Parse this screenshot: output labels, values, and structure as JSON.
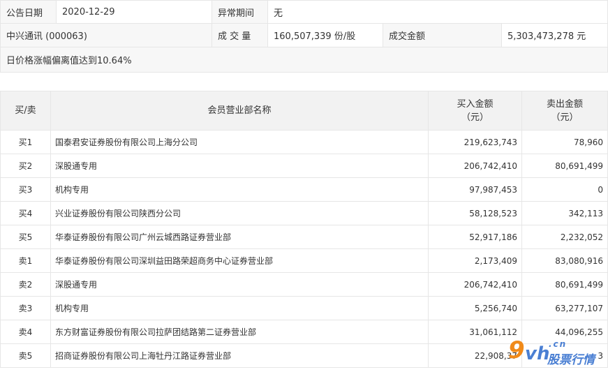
{
  "header": {
    "announce_date_label": "公告日期",
    "announce_date": "2020-12-29",
    "abnormal_period_label": "异常期间",
    "abnormal_period": "无",
    "stock": "中兴通讯 (000063)",
    "volume_label": "成 交 量",
    "volume": "160,507,339 份/股",
    "turnover_label": "成交金额",
    "turnover": "5,303,473,278 元",
    "reason": "日价格涨幅偏离值达到10.64%"
  },
  "table": {
    "col_side": "买/卖",
    "col_name": "会员营业部名称",
    "col_buy_l1": "买入金额",
    "col_buy_l2": "（元）",
    "col_sell_l1": "卖出金额",
    "col_sell_l2": "（元）",
    "rows": [
      {
        "side": "买1",
        "name": "国泰君安证券股份有限公司上海分公司",
        "buy": "219,623,743",
        "sell": "78,960"
      },
      {
        "side": "买2",
        "name": "深股通专用",
        "buy": "206,742,410",
        "sell": "80,691,499"
      },
      {
        "side": "买3",
        "name": "机构专用",
        "buy": "97,987,453",
        "sell": "0"
      },
      {
        "side": "买4",
        "name": "兴业证券股份有限公司陕西分公司",
        "buy": "58,128,523",
        "sell": "342,113"
      },
      {
        "side": "买5",
        "name": "华泰证券股份有限公司广州云城西路证券营业部",
        "buy": "52,917,186",
        "sell": "2,232,052"
      },
      {
        "side": "卖1",
        "name": "华泰证券股份有限公司深圳益田路荣超商务中心证券营业部",
        "buy": "2,173,409",
        "sell": "83,080,916"
      },
      {
        "side": "卖2",
        "name": "深股通专用",
        "buy": "206,742,410",
        "sell": "80,691,499"
      },
      {
        "side": "卖3",
        "name": "机构专用",
        "buy": "5,256,740",
        "sell": "63,277,107"
      },
      {
        "side": "卖4",
        "name": "东方财富证券股份有限公司拉萨团结路第二证券营业部",
        "buy": "31,061,112",
        "sell": "44,096,255"
      },
      {
        "side": "卖5",
        "name": "招商证券股份有限公司上海牡丹江路证券营业部",
        "buy": "22,908,37",
        "sell": "3"
      }
    ]
  },
  "watermark": {
    "nine": "9",
    "vh": "vh",
    "cn": ".cn",
    "text": "股票行情"
  }
}
